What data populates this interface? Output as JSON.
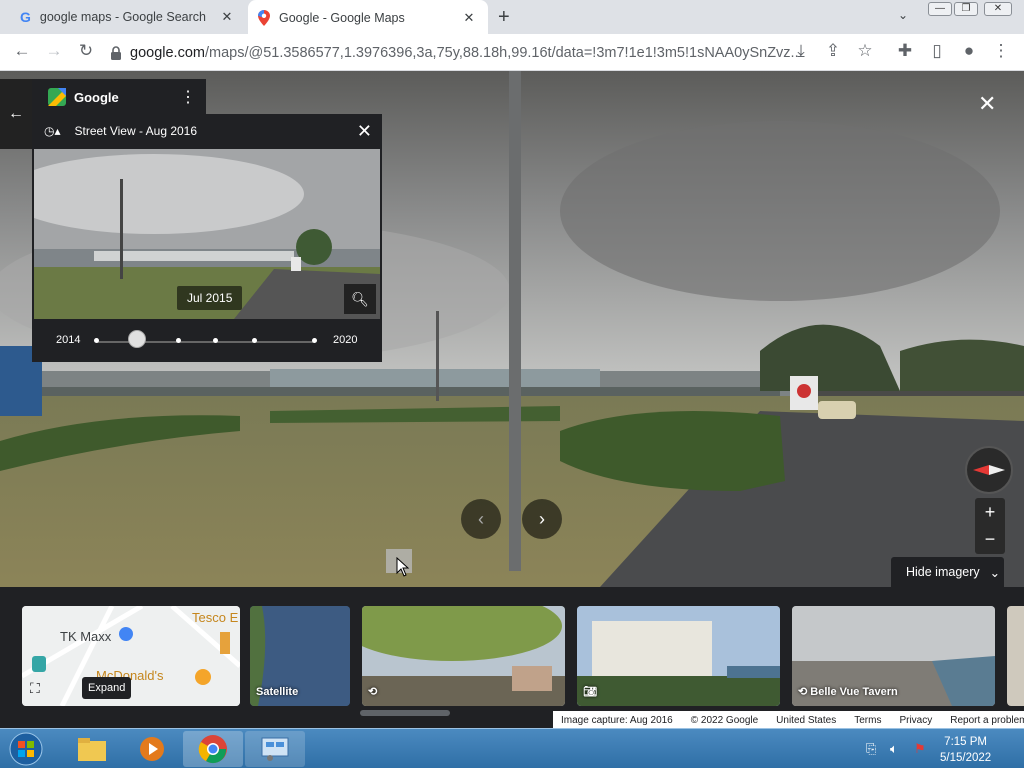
{
  "tabs": [
    {
      "title": "google maps - Google Search",
      "favicon": "google-g-icon",
      "active": false
    },
    {
      "title": "Google - Google Maps",
      "favicon": "maps-pin-icon",
      "active": true
    }
  ],
  "address_bar": {
    "url": "google.com",
    "url_rest": "/maps/@51.3586577,1.3976396,3a,75y,88.18h,99.16t/data=!3m7!1e1!3m5!1sNAA0ySnZvz..."
  },
  "header": {
    "name": "Google"
  },
  "street_view": {
    "title": "Street View - Aug 2016",
    "thumb_date": "Jul 2015",
    "year_start": "2014",
    "year_end": "2020"
  },
  "controls": {
    "hide_imagery": "Hide imagery",
    "expand_label": "Expand"
  },
  "map_card": {
    "tesco": "Tesco E",
    "tkmaxx": "TK Maxx",
    "mcdonalds": "McDonald's"
  },
  "cards": [
    {
      "label": "Satellite"
    },
    {
      "label": ""
    },
    {
      "label": ""
    },
    {
      "label": "Belle Vue Tavern"
    }
  ],
  "footer": {
    "capture": "Image capture: Aug 2016",
    "copyright": "© 2022 Google",
    "country": "United States",
    "terms": "Terms",
    "privacy": "Privacy",
    "report": "Report a problem"
  },
  "taskbar": {
    "time": "7:15 PM",
    "date": "5/15/2022"
  },
  "colors": {
    "panel": "#202124",
    "accent": "#4285f4",
    "taskbar": "#2f6fa6"
  }
}
